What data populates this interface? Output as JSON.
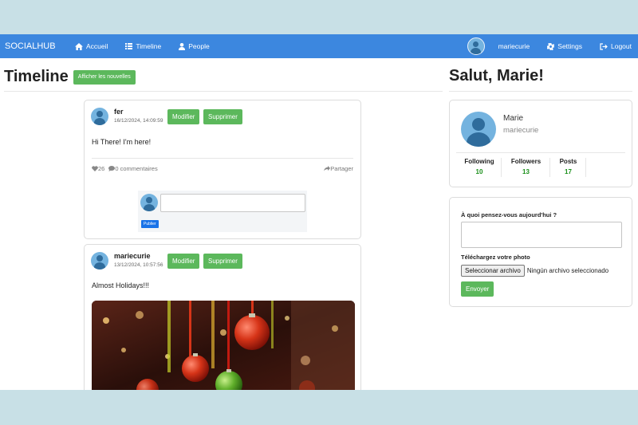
{
  "navbar": {
    "brand": "SOCIALHUB",
    "items": [
      {
        "label": "Accueil",
        "icon": "home-icon"
      },
      {
        "label": "Timeline",
        "icon": "list-icon"
      },
      {
        "label": "People",
        "icon": "person-icon"
      }
    ],
    "username": "mariecurie",
    "settings_label": "Settings",
    "logout_label": "Logout"
  },
  "timeline": {
    "title": "Timeline",
    "show_new_label": "Afficher les nouvelles"
  },
  "posts": [
    {
      "author": "fer",
      "date": "16/12/2024, 14:09:59",
      "text": "Hi There! I'm here!",
      "likes": "26",
      "comments": "0 commentaires",
      "share": "Partager",
      "edit_label": "Modifier",
      "delete_label": "Supprimer",
      "publish_label": "Publier"
    },
    {
      "author": "mariecurie",
      "date": "13/12/2024, 10:57:56",
      "text": "Almost Holidays!!!",
      "edit_label": "Modifier",
      "delete_label": "Supprimer"
    }
  ],
  "profile": {
    "greeting": "Salut, Marie!",
    "name": "Marie",
    "username": "mariecurie",
    "stats": [
      {
        "label": "Following",
        "value": "10"
      },
      {
        "label": "Followers",
        "value": "13"
      },
      {
        "label": "Posts",
        "value": "17"
      }
    ]
  },
  "composer": {
    "question": "À quoi pensez-vous aujourd'hui ?",
    "upload_label": "Téléchargez votre photo",
    "file_button": "Seleccionar archivo",
    "file_status": "Ningún archivo seleccionado",
    "submit_label": "Envoyer"
  },
  "colors": {
    "navbar": "#3c87df",
    "button_green": "#5cb85c",
    "stat_green": "#198f19",
    "page_bg": "#c8e0e6"
  }
}
